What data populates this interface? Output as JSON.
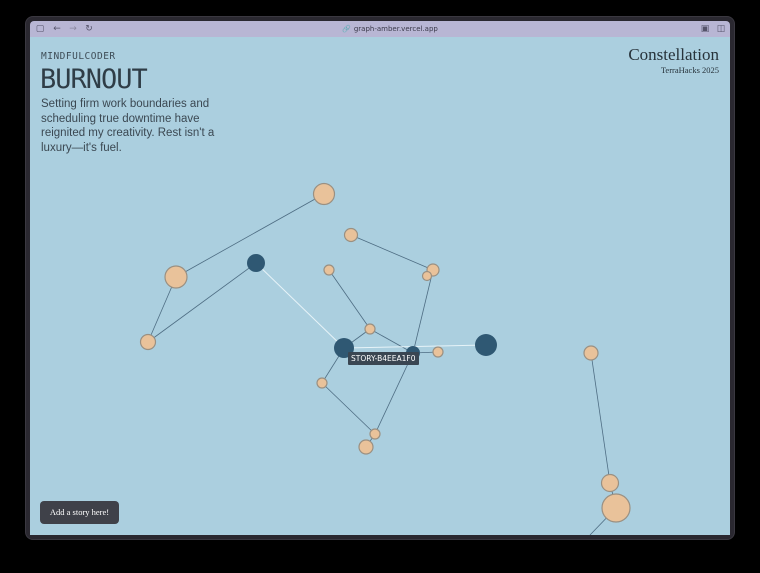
{
  "browser": {
    "url": "graph-amber.vercel.app",
    "icons": {
      "sidebar": "sidebar-icon",
      "back": "back-arrow-icon",
      "forward": "forward-arrow-icon",
      "reload": "reload-icon",
      "link": "link-icon",
      "extension": "extension-icon",
      "split": "split-view-icon"
    }
  },
  "story": {
    "username": "MINDFULCODER",
    "emotion": "BURNOUT",
    "text": "Setting firm work boundaries and scheduling true downtime have reignited my creativity. Rest isn't a luxury—it's fuel."
  },
  "brand": {
    "title": "Constellation",
    "subtitle": "TerraHacks 2025"
  },
  "tooltip": {
    "label": "STORY-B4EEA1F0"
  },
  "actions": {
    "add_story": "Add a story here!"
  },
  "colors": {
    "background": "#abcfdf",
    "node_light": "#e9c29a",
    "node_dark": "#2f5873",
    "edge": "#4e6d83",
    "edge_highlight": "#e6f3f8",
    "button": "#3f4149"
  }
}
